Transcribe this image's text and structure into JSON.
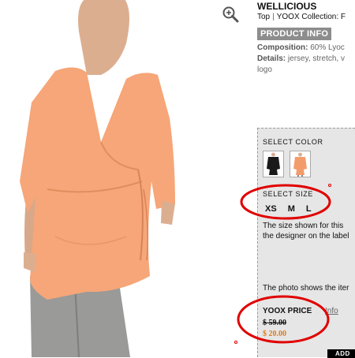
{
  "product": {
    "brand": "WELLICIOUS",
    "breadcrumb": [
      "Top",
      "YOOX Collection: F"
    ],
    "product_info_label": "PRODUCT INFO",
    "composition_label": "Composition:",
    "composition_value": "60% Lyoc",
    "details_label": "Details:",
    "details_value": "jersey, stretch, v",
    "details_more": "logo"
  },
  "panel": {
    "select_color_label": "SELECT COLOR",
    "colors": [
      "black",
      "peach"
    ],
    "select_size_label": "SELECT SIZE",
    "sizes": [
      "XS",
      "M",
      "L"
    ],
    "size_note_lines": [
      "The size shown for this",
      "the designer on the label"
    ],
    "photo_note": "The photo shows the iter",
    "yoox_price_label": "YOOX PRICE",
    "info_link": "Info",
    "old_price": "$ 59.00",
    "new_price": "$ 20.00",
    "add_button": "ADD"
  },
  "icons": {
    "zoom": "magnifier-plus-icon"
  },
  "colors": {
    "price_accent": "#e07a1a",
    "annotation_red": "#e00000",
    "badge_gray": "#8d8d8d",
    "panel_bg": "#e6e6e6"
  }
}
